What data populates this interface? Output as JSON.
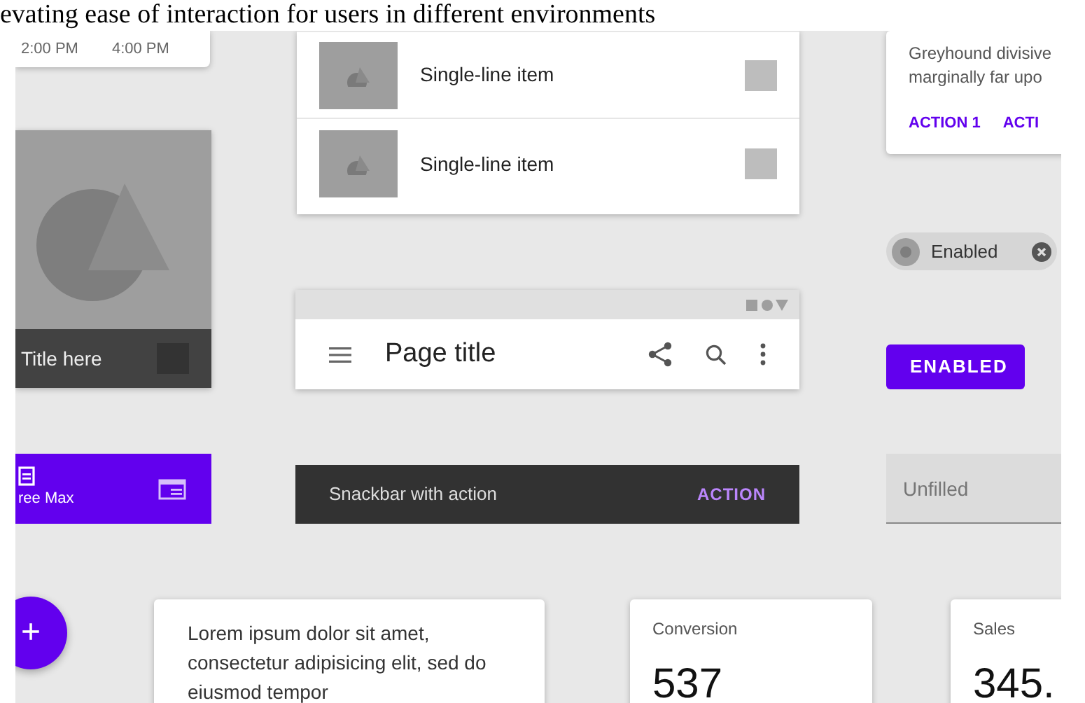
{
  "banner": "evating ease of interaction for users in different environments",
  "time_card": {
    "times": [
      "2:00 PM",
      "4:00 PM"
    ]
  },
  "image_card": {
    "kind": "picture",
    "title": "Title here"
  },
  "list": {
    "items": [
      {
        "label": "Single-line item",
        "checked": false
      },
      {
        "label": "Single-line item",
        "checked": false
      }
    ]
  },
  "app_bar": {
    "title": "Page title"
  },
  "snackbar": {
    "message": "Snackbar with action",
    "action": "ACTION"
  },
  "bottom_nav": {
    "items": [
      {
        "label": "ree Max",
        "selected": true
      },
      {
        "selected": false
      }
    ]
  },
  "fab": {
    "label": "+"
  },
  "text_card": {
    "text": "Lorem ipsum dolor sit amet, consectetur adipisicing elit, sed do eiusmod tempor"
  },
  "stats": [
    {
      "label": "Conversion",
      "value": "537"
    },
    {
      "label": "Sales",
      "value": "345."
    }
  ],
  "info_card": {
    "lines": [
      "Greyhound divisive",
      "marginally far upo"
    ],
    "actions": [
      "ACTION 1",
      "ACTI"
    ]
  },
  "chip": {
    "label": "Enabled"
  },
  "button": {
    "label": "ENABLED"
  },
  "field": {
    "placeholder": "Unfilled"
  }
}
